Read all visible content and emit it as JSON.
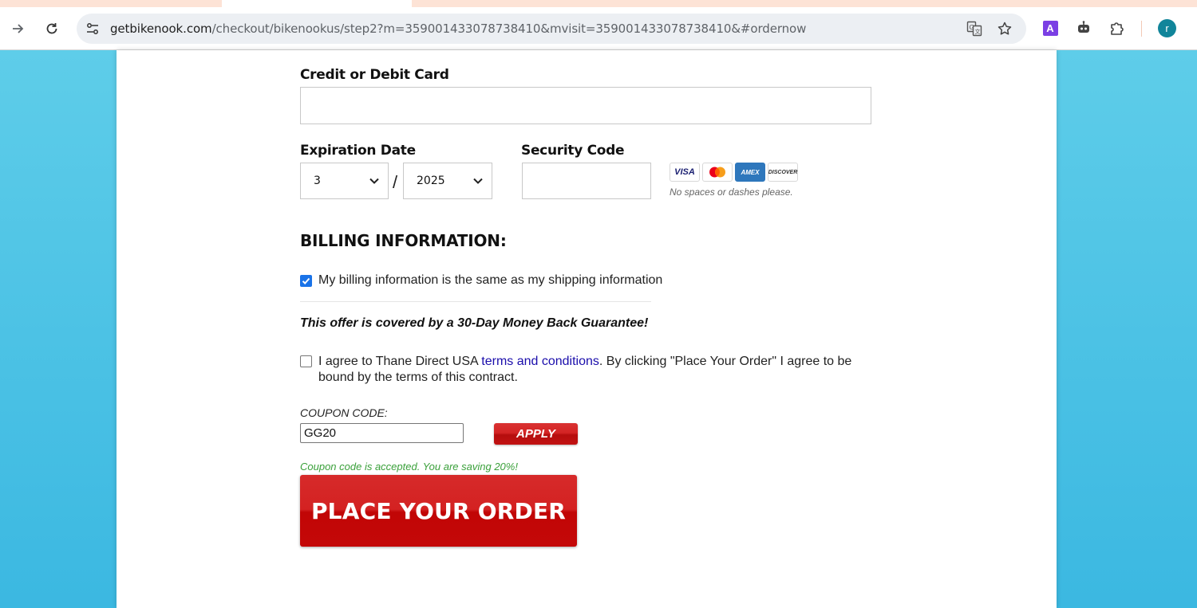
{
  "browser": {
    "url_host": "getbikenook.com",
    "url_path": "/checkout/bikenookus/step2?m=359001433078738410&mvisit=359001433078738410&#ordernow",
    "extension_badge": "A",
    "profile_initial": "r"
  },
  "payment": {
    "card_label": "Credit or Debit Card",
    "card_value": "",
    "expiration_label": "Expiration Date",
    "exp_month": "3",
    "exp_separator": "/",
    "exp_year": "2025",
    "security_label": "Security Code",
    "security_value": "",
    "card_brands": [
      "VISA",
      "mastercard",
      "AMEX",
      "DISCOVER"
    ],
    "card_note": "No spaces or dashes please."
  },
  "billing": {
    "heading": "BILLING INFORMATION:",
    "same_as_shipping_label": "My billing information is the same as my shipping information",
    "same_as_shipping_checked": true
  },
  "guarantee": "This offer is covered by a 30-Day Money Back Guarantee!",
  "terms": {
    "checked": false,
    "prefix": "I agree to Thane Direct USA ",
    "link_text": "terms and conditions",
    "suffix": ". By clicking \"Place Your Order\" I agree to be bound by the terms of this contract."
  },
  "coupon": {
    "label": "COUPON CODE:",
    "value": "GG20",
    "apply_label": "APPLY",
    "success_message": "Coupon code is accepted. You are saving 20%!"
  },
  "order_button_label": "PLACE YOUR ORDER",
  "colors": {
    "accent_red": "#c10606",
    "success_green": "#3aa03a",
    "link_blue": "#1a0dab",
    "page_background": "#3fb6e0"
  }
}
